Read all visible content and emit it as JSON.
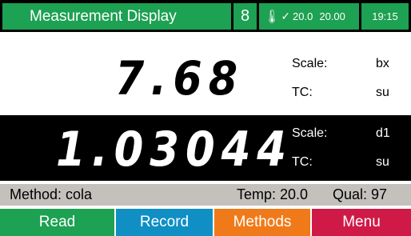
{
  "header": {
    "title": "Measurement Display",
    "hold_icon": "8",
    "temperature": {
      "icon": "thermometer-icon",
      "check": "✓",
      "value1": "20.0",
      "value2": "20.00"
    },
    "time": "19:15"
  },
  "primary": {
    "reading": "7.68",
    "scale_label": "Scale:",
    "scale_value": "bx",
    "tc_label": "TC:",
    "tc_value": "su"
  },
  "secondary": {
    "reading": "1.03044",
    "scale_label": "Scale:",
    "scale_value": "d1",
    "tc_label": "TC:",
    "tc_value": "su"
  },
  "status": {
    "method": "Method:  cola",
    "temp": "Temp: 20.0",
    "qual": "Qual: 97"
  },
  "buttons": {
    "read": "Read",
    "record": "Record",
    "methods": "Methods",
    "menu": "Menu"
  },
  "colors": {
    "header_green": "#1da152",
    "read": "#1da152",
    "record": "#0f8fc4",
    "methods": "#f07a1a",
    "menu": "#cf1a48",
    "status_bar": "#c4c1bd"
  }
}
